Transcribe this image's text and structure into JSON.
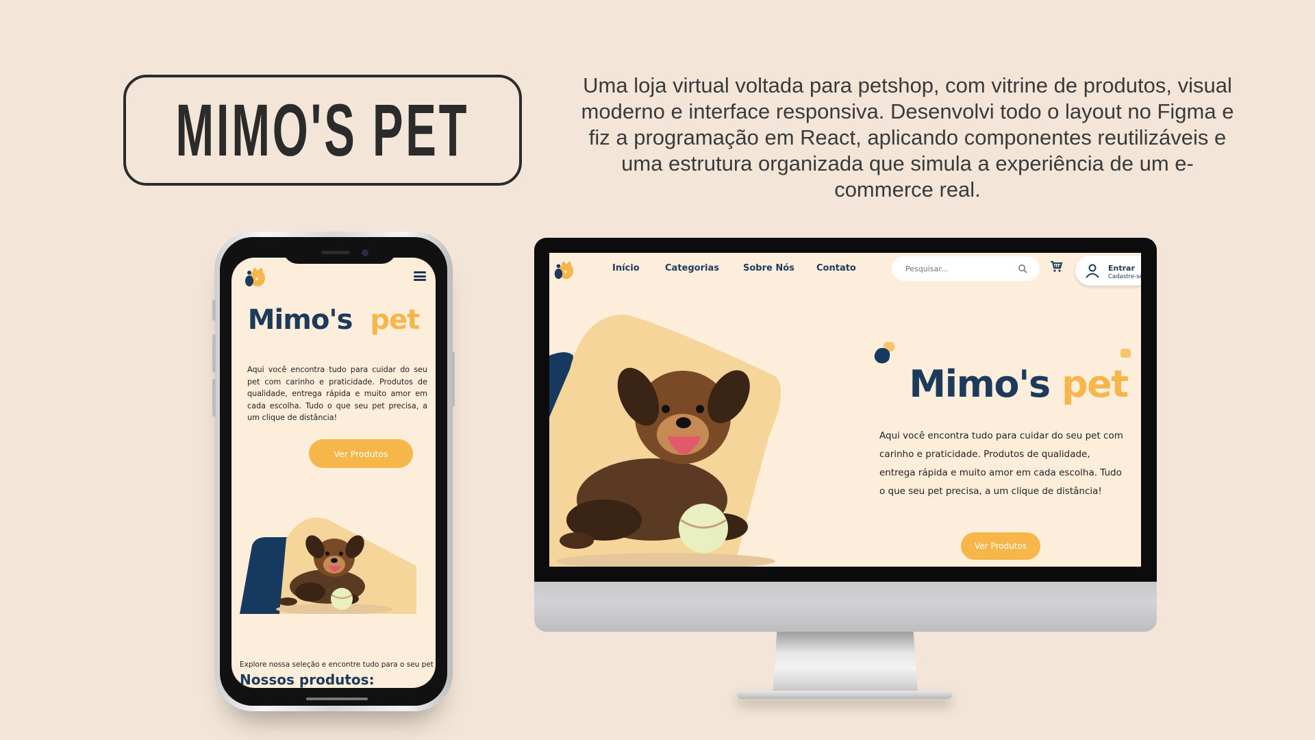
{
  "title": "MIMO'S PET",
  "description": "Uma loja virtual voltada para petshop, com vitrine de produtos, visual moderno e interface responsiva. Desenvolvi todo o layout no Figma e fiz a programação em React, aplicando componentes reutilizáveis e uma estrutura organizada que simula a experiência de um e-commerce real.",
  "colors": {
    "background": "#f3e6d8",
    "navy": "#1b3a5c",
    "orange": "#f7b64a",
    "cream": "#fdeedb"
  },
  "brand": {
    "part1": "Mimo's",
    "part2": "pet"
  },
  "hero_text": "Aqui você encontra tudo para cuidar do seu pet com carinho e praticidade. Produtos de qualidade, entrega rápida e muito amor em cada escolha. Tudo o que seu pet precisa, a um clique de distância!",
  "cta_label": "Ver Produtos",
  "mobile": {
    "menu_icon": "hamburger-icon",
    "explore_text": "Explore nossa seleção e encontre tudo para o seu pet",
    "products_heading": "Nossos produtos:"
  },
  "desktop": {
    "nav": [
      "Início",
      "Categorias",
      "Sobre Nós",
      "Contato"
    ],
    "search_placeholder": "Pesquisar...",
    "search_icon": "search-icon",
    "cart_icon": "cart-icon",
    "login": {
      "label": "Entrar",
      "sub": "Cadastre-se"
    }
  }
}
